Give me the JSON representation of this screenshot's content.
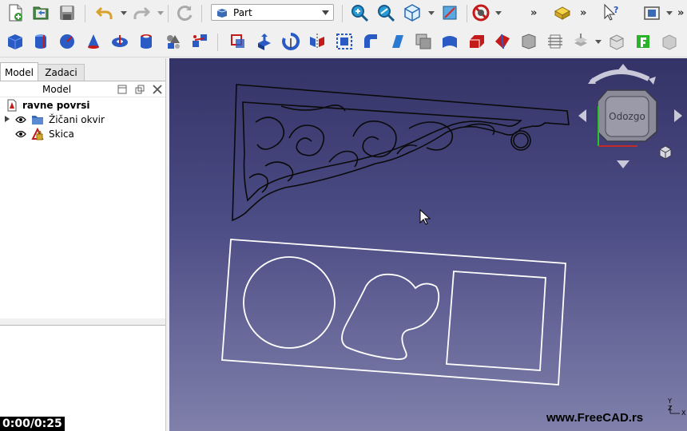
{
  "toolbar": {
    "workbench_label": "Part",
    "icons_row1": [
      "new-document-icon",
      "open-icon",
      "save-icon",
      "undo-icon",
      "redo-icon",
      "refresh-icon",
      "fit-all-icon",
      "fit-selection-icon",
      "view-isometric-icon",
      "std-measure-icon",
      "no-draw-style-icon",
      "part-workbench-icon",
      "whats-this-icon",
      "bounding-box-icon"
    ],
    "icons_row2": [
      "part-box-icon",
      "part-cylinder-icon",
      "part-sphere-icon",
      "part-cone-icon",
      "part-torus-icon",
      "part-tube-icon",
      "part-primitives-icon",
      "part-shape-builder-icon",
      "part-from-shape-icon",
      "part-extrude-icon",
      "part-revolve-icon",
      "part-mirror-icon",
      "part-fillet-icon",
      "part-chamfer-icon",
      "part-make-face-icon",
      "part-ruled-surface-icon",
      "part-loft-icon",
      "part-sweep-icon",
      "part-section-icon",
      "part-cross-sections-icon",
      "part-offset-icon",
      "part-thickness-icon",
      "part-boolean-icon",
      "part-cut-icon"
    ]
  },
  "panel": {
    "tabs": [
      "Model",
      "Zadaci"
    ],
    "active_tab": "Model",
    "header_title": "Model",
    "tree": [
      {
        "label": "ravne povrsi",
        "icon": "document-icon",
        "bold": true
      },
      {
        "label": "Žičani okvir",
        "icon": "folder-icon",
        "expandable": true,
        "visible": true
      },
      {
        "label": "Skica",
        "icon": "sketch-icon",
        "visible": true
      }
    ]
  },
  "player": {
    "time": "0:00/0:25"
  },
  "view": {
    "navcube_face": "Odozgo",
    "watermark": "www.FreeCAD.rs",
    "axis_labels": [
      "Y",
      "Z",
      "X"
    ],
    "bg_top": "#333367",
    "bg_bottom": "#8080ab",
    "line_color": "#ffffff",
    "bracket_color": "#0a0a0a"
  }
}
